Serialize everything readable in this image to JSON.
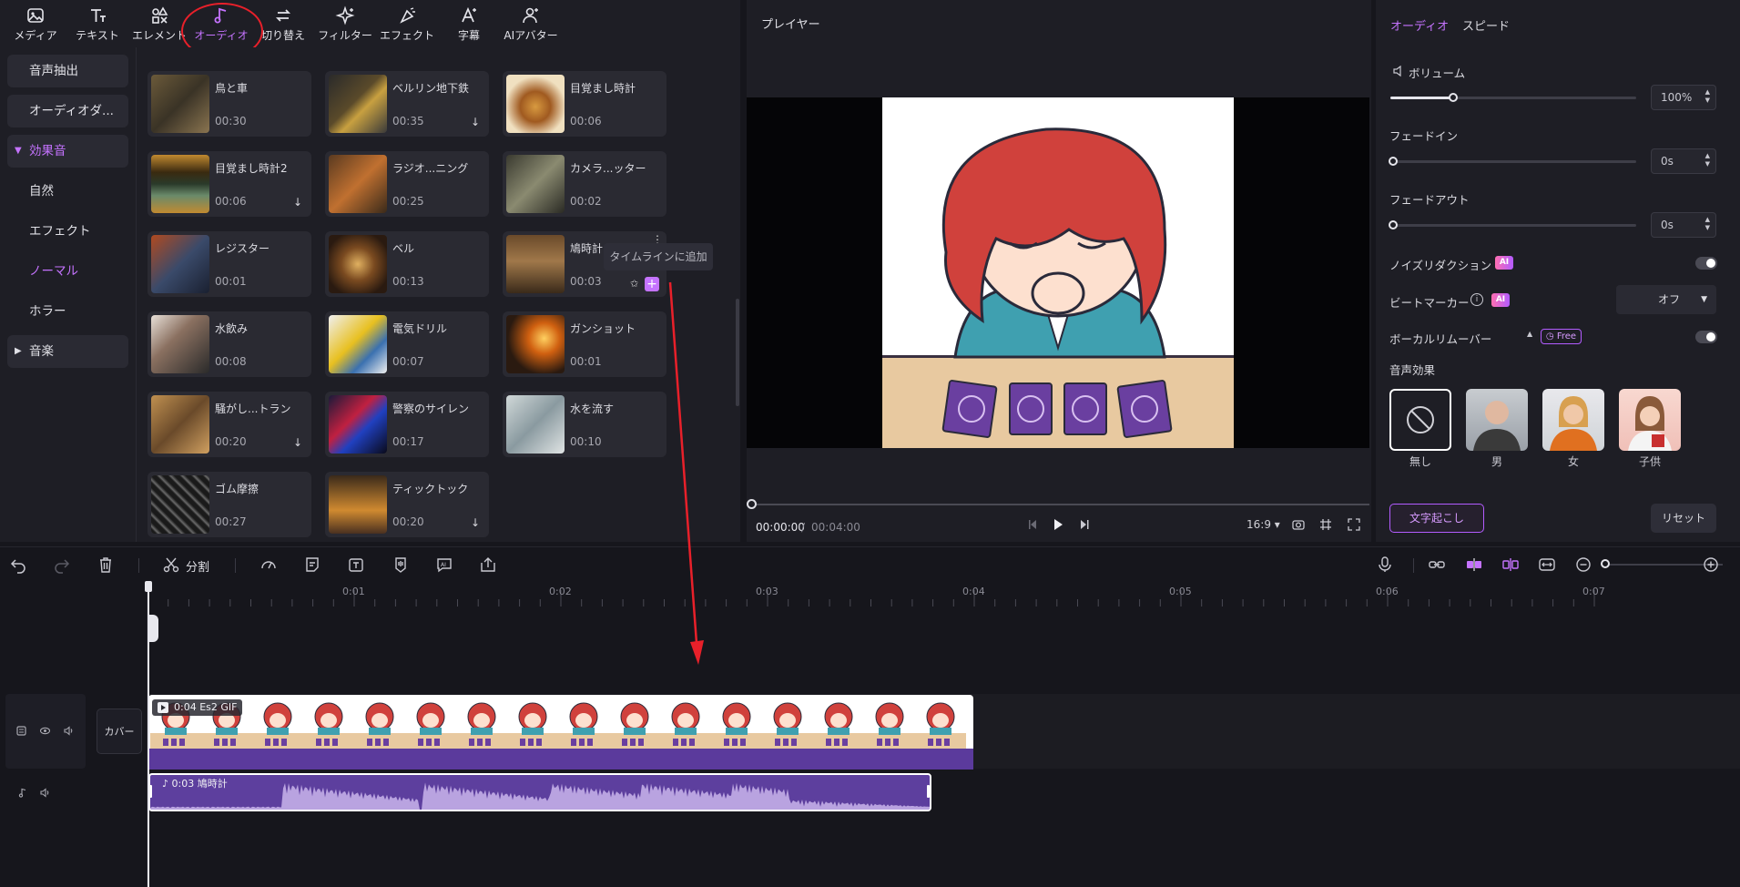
{
  "toolbar": {
    "items": [
      {
        "label": "メディア",
        "icon": "image-icon"
      },
      {
        "label": "テキスト",
        "icon": "text-icon"
      },
      {
        "label": "エレメント",
        "icon": "elements-icon"
      },
      {
        "label": "オーディオ",
        "icon": "music-note-icon"
      },
      {
        "label": "切り替え",
        "icon": "transition-icon"
      },
      {
        "label": "フィルター",
        "icon": "filter-sparkle-icon"
      },
      {
        "label": "エフェクト",
        "icon": "effect-icon"
      },
      {
        "label": "字幕",
        "icon": "caption-icon"
      },
      {
        "label": "AIアバター",
        "icon": "avatar-icon"
      }
    ],
    "active": "オーディオ"
  },
  "categories": {
    "items": [
      {
        "label": "音声抽出",
        "style": "box"
      },
      {
        "label": "オーディオダ...",
        "style": "box"
      },
      {
        "label": "効果音",
        "style": "box",
        "expanded": true
      },
      {
        "label": "自然",
        "style": "sub"
      },
      {
        "label": "エフェクト",
        "style": "sub"
      },
      {
        "label": "ノーマル",
        "style": "sub",
        "selected": true
      },
      {
        "label": "ホラー",
        "style": "sub"
      },
      {
        "label": "音楽",
        "style": "box",
        "expanded": false
      }
    ]
  },
  "sounds": [
    {
      "name": "鳥と車",
      "duration": "00:30",
      "download": false
    },
    {
      "name": "ベルリン地下鉄",
      "duration": "00:35",
      "download": true
    },
    {
      "name": "目覚まし時計",
      "duration": "00:06",
      "download": false
    },
    {
      "name": "目覚まし時計2",
      "duration": "00:06",
      "download": true
    },
    {
      "name": "ラジオ...ニング",
      "duration": "00:25",
      "download": false
    },
    {
      "name": "カメラ...ッター",
      "duration": "00:02",
      "download": false
    },
    {
      "name": "レジスター",
      "duration": "00:01",
      "download": false
    },
    {
      "name": "ベル",
      "duration": "00:13",
      "download": false
    },
    {
      "name": "鳩時計",
      "duration": "00:03",
      "download": false,
      "hovered": true
    },
    {
      "name": "水飲み",
      "duration": "00:08",
      "download": false
    },
    {
      "name": "電気ドリル",
      "duration": "00:07",
      "download": false
    },
    {
      "name": "ガンショット",
      "duration": "00:01",
      "download": false
    },
    {
      "name": "騒がし...トラン",
      "duration": "00:20",
      "download": true
    },
    {
      "name": "警察のサイレン",
      "duration": "00:17",
      "download": false
    },
    {
      "name": "水を流す",
      "duration": "00:10",
      "download": false
    },
    {
      "name": "ゴム摩擦",
      "duration": "00:27",
      "download": false
    },
    {
      "name": "ティックトック",
      "duration": "00:20",
      "download": true
    }
  ],
  "tooltip": "タイムラインに追加",
  "player": {
    "title": "プレイヤー",
    "current_time": "00:00:00",
    "separator": "/",
    "total_time": "00:04:00",
    "aspect_ratio": "16:9",
    "progress": 0
  },
  "right_panel": {
    "tabs": [
      "オーディオ",
      "スピード"
    ],
    "active_tab": "オーディオ",
    "volume_label": "ボリューム",
    "volume_value": "100%",
    "volume_level": 0.21,
    "fade_in_label": "フェードイン",
    "fade_in_value": "0s",
    "fade_out_label": "フェードアウト",
    "fade_out_value": "0s",
    "noise_reduction_label": "ノイズリダクション",
    "beat_marker_label": "ビートマーカー",
    "beat_marker_value": "オフ",
    "vocal_remover_label": "ボーカルリムーバー",
    "free_badge": "Free",
    "ai_badge": "AI",
    "voice_effects_label": "音声効果",
    "voices": [
      {
        "label": "無し",
        "selected": true
      },
      {
        "label": "男"
      },
      {
        "label": "女"
      },
      {
        "label": "子供"
      }
    ],
    "transcribe_button": "文字起こし",
    "reset_button": "リセット"
  },
  "timeline": {
    "split_label": "分割",
    "ruler_labels": [
      "0:01",
      "0:02",
      "0:03",
      "0:04",
      "0:05",
      "0:06",
      "0:07"
    ],
    "cover_label": "カバー",
    "video_clip_label": "0:04 Es2 GIF",
    "audio_clip_label": "0:03 鳩時計"
  },
  "colors": {
    "accent": "#c573ff",
    "audio_clip": "#5d3f9e",
    "annotation_red": "#e8202a"
  }
}
